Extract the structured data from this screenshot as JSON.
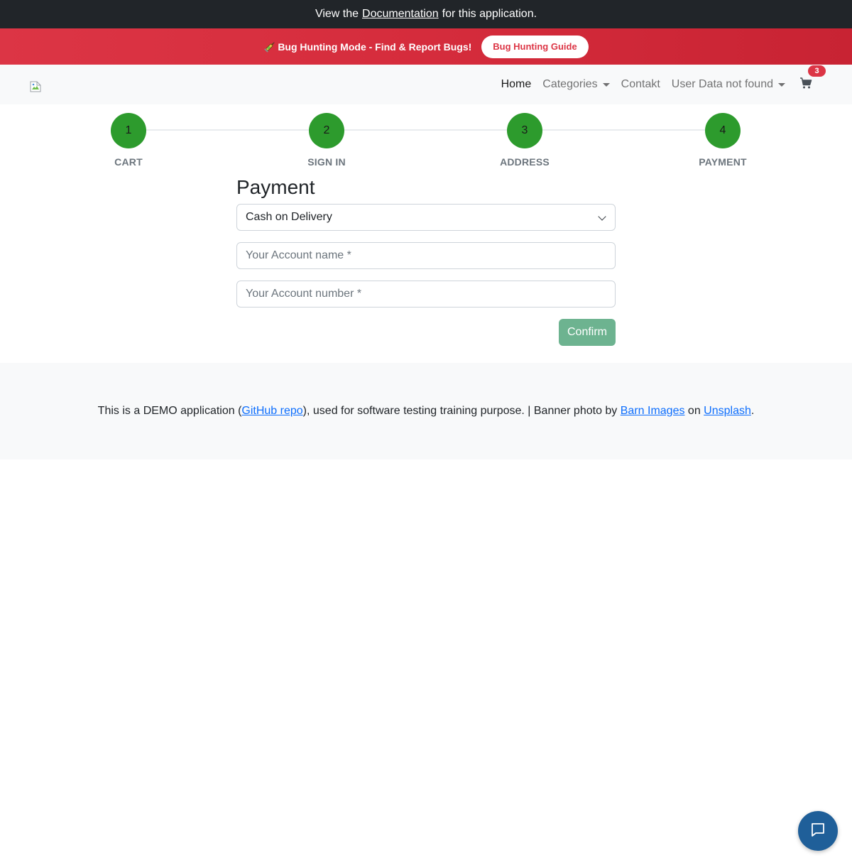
{
  "top_bar": {
    "prefix": "View the",
    "link": "Documentation",
    "suffix": "for this application."
  },
  "bug_banner": {
    "icon": "syringe-icon",
    "text": "Bug Hunting Mode - Find & Report Bugs!",
    "button": "Bug Hunting Guide"
  },
  "navbar": {
    "logo": "broken-image-icon",
    "items": [
      {
        "label": "Home"
      },
      {
        "label": "Categories"
      },
      {
        "label": "Contakt"
      },
      {
        "label": "User Data not found"
      }
    ],
    "cart_icon": "cart-icon",
    "cart_count": "3"
  },
  "stepper": {
    "steps": [
      {
        "number": "1",
        "label": "CART"
      },
      {
        "number": "2",
        "label": "SIGN IN"
      },
      {
        "number": "3",
        "label": "ADDRESS"
      },
      {
        "number": "4",
        "label": "PAYMENT"
      }
    ]
  },
  "payment": {
    "title": "Payment",
    "method_selected": "Cash on Delivery",
    "account_name_placeholder": "Your Account name *",
    "account_number_placeholder": "Your Account number *",
    "confirm": "Confirm"
  },
  "footer": {
    "t1": "This is a DEMO application (",
    "github": "GitHub repo",
    "t2": "), used for software testing training purpose. | Banner photo by ",
    "barn": "Barn Images",
    "t3": " on ",
    "unsplash": "Unsplash",
    "t4": "."
  },
  "chat": {
    "icon": "chat-icon"
  },
  "colors": {
    "top_bar": "#212529",
    "banner": "#dc3545",
    "step_complete": "#2d9b2d",
    "confirm": "#6db390",
    "link": "#0d6efd",
    "chat": "#1f5f99"
  }
}
